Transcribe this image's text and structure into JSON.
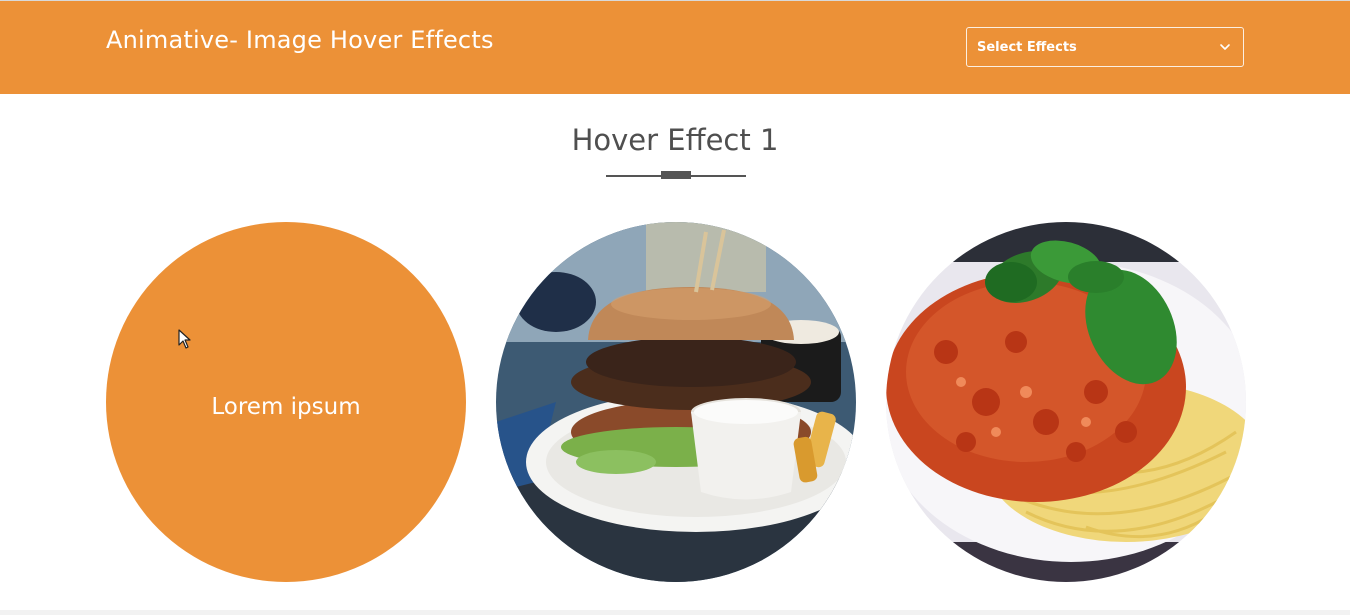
{
  "header": {
    "title": "Animative- Image Hover Effects",
    "background_color": "#ec9137",
    "select": {
      "label": "Select Effects",
      "icon": "chevron-down-icon"
    }
  },
  "section": {
    "title": "Hover Effect 1"
  },
  "cards": [
    {
      "overlay_text": "Lorem ipsum",
      "state": "hovered",
      "overlay_color": "#ec9137"
    },
    {
      "image": "burger-photo"
    },
    {
      "image": "spaghetti-photo"
    }
  ]
}
